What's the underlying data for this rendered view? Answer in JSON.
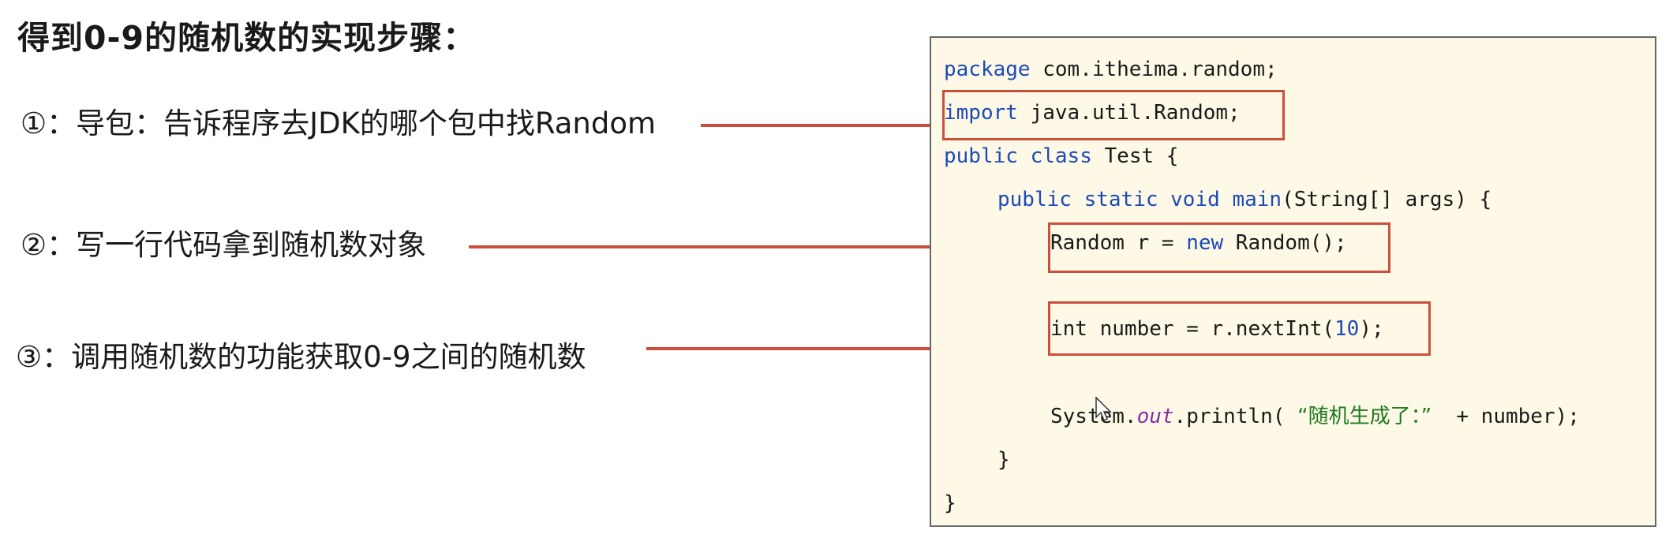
{
  "title": "得到0-9的随机数的实现步骤：",
  "steps": [
    "①：导包：告诉程序去JDK的哪个包中找Random",
    "②：写一行代码拿到随机数对象",
    "③：调用随机数的功能获取0-9之间的随机数"
  ],
  "code": {
    "line1": {
      "kw": "package",
      "rest": " com.itheima.random;"
    },
    "line2": {
      "kw": "import",
      "rest": " java.util.Random;"
    },
    "line3": {
      "kw1": "public",
      "kw2": "class",
      "rest": " Test {"
    },
    "line4": {
      "kw1": "public",
      "kw2": "static",
      "kw3": "void",
      "method": "main",
      "rest": "(String[] args) {"
    },
    "line5": {
      "pre": "Random r = ",
      "kw": "new",
      "rest": " Random();"
    },
    "line6": {
      "pre": "int number = r.nextInt(",
      "num": "10",
      "rest": ");"
    },
    "line7": {
      "pre": "System.",
      "field": "out",
      "mid": ".println( ",
      "str": "“随机生成了：”",
      "rest": "  + number);"
    },
    "line8": "}",
    "line9": "}"
  },
  "colors": {
    "keyword": "#1d4ab7",
    "string": "#1f7a1f",
    "field": "#8a2aa5",
    "highlight": "#c9503d",
    "code_background": "#fdf9e6"
  }
}
